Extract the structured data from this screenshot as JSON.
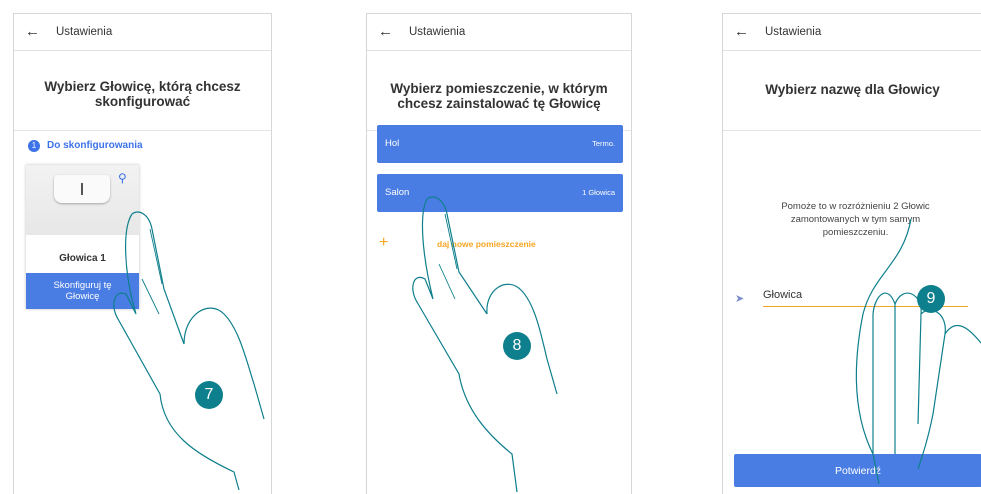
{
  "screens": [
    {
      "header_title": "Ustawienia",
      "page_title_line1": "Wybierz Głowicę, którą chcesz",
      "page_title_line2": "skonfigurować",
      "section_number": "1",
      "section_label": "Do skonfigurowania",
      "card_name": "Głowica 1",
      "card_button_line1": "Skonfiguruj tę",
      "card_button_line2": "Głowicę",
      "step": "7"
    },
    {
      "header_title": "Ustawienia",
      "page_title_line1": "Wybierz pomieszczenie, w którym",
      "page_title_line2": "chcesz zainstalować tę Głowicę",
      "rooms": [
        {
          "name": "Hol",
          "meta": "Termo."
        },
        {
          "name": "Salon",
          "meta": "1 Głowica"
        }
      ],
      "add_room_label": "daj nowe pomieszczenie",
      "step": "8"
    },
    {
      "header_title": "Ustawienia",
      "page_title": "Wybierz nazwę dla Głowicy",
      "hint_line1": "Pomoże to w rozróżnieniu 2 Głowic",
      "hint_line2": "zamontowanych w tym samym",
      "hint_line3": "pomieszczeniu.",
      "name_value": "Głowica",
      "confirm_label": "Potwierdź",
      "step": "9"
    }
  ],
  "icons": {
    "back": "arrow-left-icon",
    "bulb": "light-bulb-icon",
    "plus": "plus-icon",
    "tag": "tag-icon"
  },
  "colors": {
    "primary": "#4a7de3",
    "accent": "#f5a623",
    "step_badge": "#0e7f8c"
  }
}
